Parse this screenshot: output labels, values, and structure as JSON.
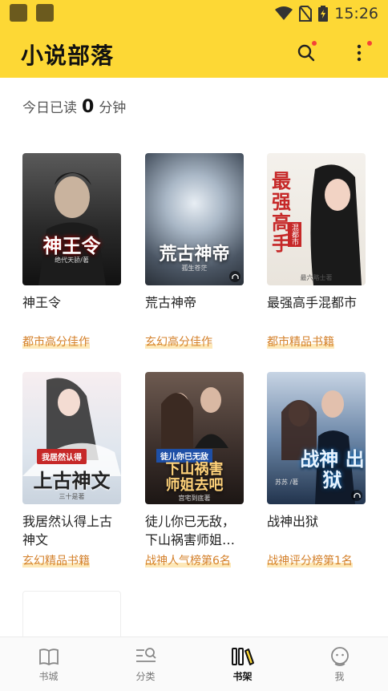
{
  "status_bar": {
    "time": "15:26"
  },
  "app": {
    "title": "小说部落"
  },
  "reading": {
    "prefix": "今日已读",
    "minutes": "0",
    "suffix": "分钟"
  },
  "books": [
    {
      "title": "神王令",
      "tag": "都市高分佳作",
      "cover_title": "神王令",
      "cover_author": "绝代天骄/著"
    },
    {
      "title": "荒古神帝",
      "tag": "玄幻高分佳作",
      "cover_title": "荒古神帝",
      "cover_author": "孤生苍茫"
    },
    {
      "title": "最强高手混都市",
      "tag": "都市精品书籍",
      "cover_title": "最强高手",
      "cover_sub": "混都市",
      "cover_author": "最六略士著"
    },
    {
      "title": "我居然认得上古神文",
      "tag": "玄幻精品书籍",
      "cover_title": "上古神文",
      "cover_sub": "我居然认得",
      "cover_author": "三十是著"
    },
    {
      "title": "徒儿你已无敌，下山祸害师姐…",
      "tag": "战神人气榜第6名",
      "cover_title": "下山祸害 师姐去吧",
      "cover_sub": "徒儿你已无敌",
      "cover_author": "宫宅到底著"
    },
    {
      "title": "战神出狱",
      "tag": "战神评分榜第1名",
      "cover_title": "战神 出狱",
      "cover_author": "苏苏 /著"
    }
  ],
  "tabs": [
    {
      "label": "书城",
      "icon": "book-icon"
    },
    {
      "label": "分类",
      "icon": "category-search-icon"
    },
    {
      "label": "书架",
      "icon": "bookshelf-icon",
      "active": true
    },
    {
      "label": "我",
      "icon": "profile-icon"
    }
  ],
  "colors": {
    "accent": "#fdd835",
    "tag": "#d4802a",
    "badge": "#f44336"
  }
}
